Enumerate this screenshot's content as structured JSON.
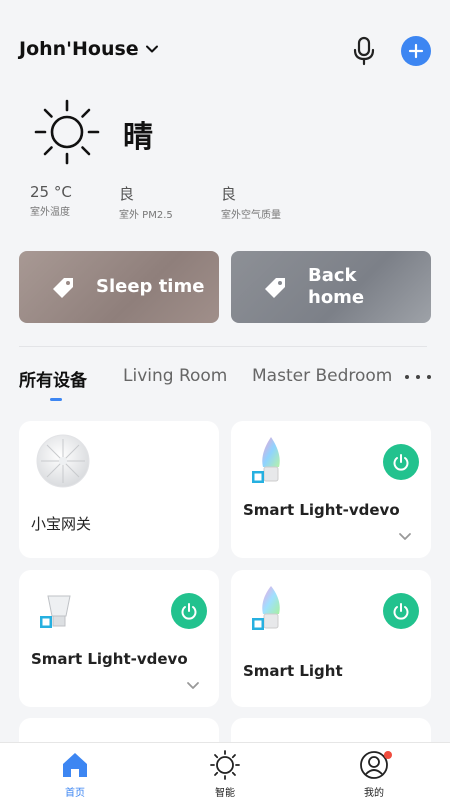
{
  "header": {
    "house_name": "John'House",
    "icons": {
      "mic": "microphone-icon",
      "add": "plus-icon",
      "dropdown": "chevron-down-icon"
    }
  },
  "weather": {
    "icon": "sun-icon",
    "condition": "晴",
    "metrics": [
      {
        "value": "25 °C",
        "label": "室外温度"
      },
      {
        "value": "良",
        "label": "室外 PM2.5"
      },
      {
        "value": "良",
        "label": "室外空气质量"
      }
    ]
  },
  "scenes": [
    {
      "label": "Sleep time",
      "icon": "tag-icon"
    },
    {
      "label_line1": "Back",
      "label_line2": "home",
      "icon": "tag-icon"
    }
  ],
  "tabs": {
    "items": [
      "所有设备",
      "Living Room",
      "Master Bedroom"
    ],
    "active_index": 0,
    "more_icon": "more-dots-icon"
  },
  "devices": [
    {
      "name": "小宝网关",
      "icon": "gateway-icon",
      "has_power": false
    },
    {
      "name": "Smart Light-vdevo",
      "icon": "candle-bulb-icon",
      "has_power": true,
      "power_on": true
    },
    {
      "name": "Smart Light-vdevo",
      "icon": "spot-bulb-icon",
      "has_power": true,
      "power_on": true
    },
    {
      "name": "Smart Light",
      "icon": "candle-bulb-icon",
      "has_power": true,
      "power_on": true
    }
  ],
  "bottom_nav": [
    {
      "label": "首页",
      "icon": "home-icon",
      "active": true
    },
    {
      "label": "智能",
      "icon": "smart-sun-icon",
      "active": false
    },
    {
      "label": "我的",
      "icon": "profile-icon",
      "active": false,
      "badge": true
    }
  ],
  "colors": {
    "accent": "#3d86f2",
    "power_green": "#22c28e",
    "badge_red": "#f04c3e",
    "background": "#f4f5f7"
  }
}
